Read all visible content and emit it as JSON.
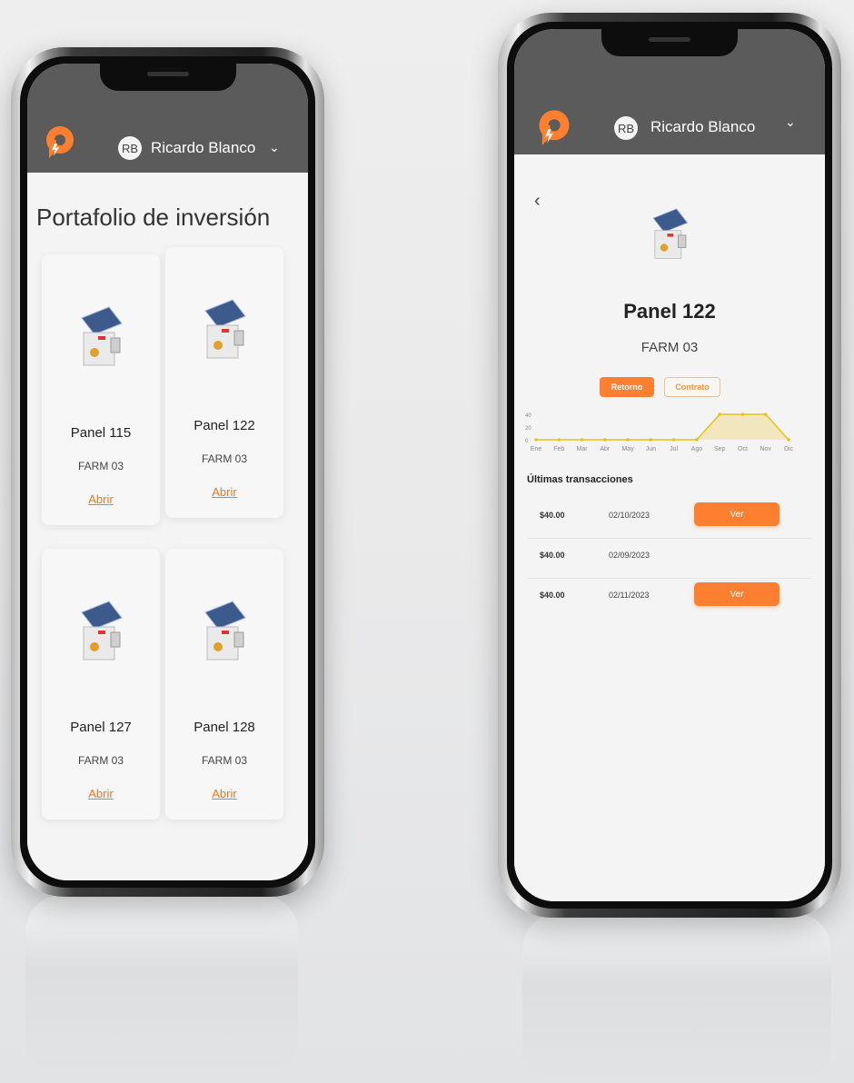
{
  "user": {
    "initials": "RB",
    "name": "Ricardo Blanco"
  },
  "portfolio": {
    "title": "Portafolio de inversión",
    "cards": [
      {
        "name": "Panel 115",
        "farm": "FARM 03",
        "link": "Abrir"
      },
      {
        "name": "Panel 122",
        "farm": "FARM 03",
        "link": "Abrir"
      },
      {
        "name": "Panel 127",
        "farm": "FARM 03",
        "link": "Abrir"
      },
      {
        "name": "Panel 128",
        "farm": "FARM 03",
        "link": "Abrir"
      }
    ]
  },
  "detail": {
    "back_icon": "chevron-left-icon",
    "name": "Panel 122",
    "farm": "FARM 03",
    "tabs": {
      "retorno": "Retorno",
      "contrato": "Contrato"
    },
    "transactions_title": "Últimas transacciones",
    "transactions": [
      {
        "amount": "$40.00",
        "date": "02/10/2023",
        "action": "Ver"
      },
      {
        "amount": "$40.00",
        "date": "02/09/2023",
        "action": ""
      },
      {
        "amount": "$40.00",
        "date": "02/11/2023",
        "action": "Ver"
      }
    ]
  },
  "colors": {
    "accent": "#ff7f30",
    "link": "#e47a27",
    "appbar": "#5b5b5b",
    "line": "#e6c21a"
  },
  "chart_data": {
    "type": "area",
    "categories": [
      "Ene",
      "Feb",
      "Mar",
      "Abr",
      "May",
      "Jun",
      "Jul",
      "Ago",
      "Sep",
      "Oct",
      "Nov",
      "Dic"
    ],
    "values": [
      0,
      0,
      0,
      0,
      0,
      0,
      0,
      0,
      40,
      40,
      40,
      0
    ],
    "yticks": [
      "40",
      "20",
      "0"
    ],
    "ylim": [
      0,
      40
    ]
  }
}
